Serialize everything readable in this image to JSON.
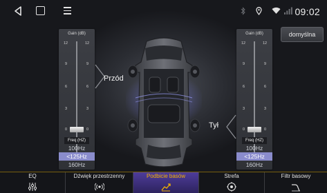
{
  "status": {
    "time": "09:02"
  },
  "default_button": "domyślna",
  "left_panel": {
    "gain_title": "Gain (dB)",
    "ticks": [
      "12",
      "9",
      "6",
      "3",
      "0"
    ],
    "freq_title": "Freq (HZ)",
    "options": [
      "100Hz",
      "<125Hz",
      "160Hz"
    ],
    "selected_index": 1,
    "gain_value_db": 0
  },
  "right_panel": {
    "gain_title": "Gain (dB)",
    "ticks": [
      "12",
      "9",
      "6",
      "3",
      "0"
    ],
    "freq_title": "Freq (HZ)",
    "options": [
      "100Hz",
      "<125Hz",
      "160Hz"
    ],
    "selected_index": 1,
    "gain_value_db": 0
  },
  "labels": {
    "front": "Przód",
    "rear": "Tył"
  },
  "tabs": [
    {
      "label": "EQ",
      "icon": "equalizer-icon"
    },
    {
      "label": "Dźwięk przestrzenny",
      "icon": "surround-icon"
    },
    {
      "label": "Podbicie basów",
      "icon": "bass-boost-icon",
      "active": true
    },
    {
      "label": "Strefa",
      "icon": "zone-icon"
    },
    {
      "label": "Filtr basowy",
      "icon": "bass-filter-icon"
    }
  ],
  "colors": {
    "accent": "#f4b200",
    "selected": "#8a8ccc",
    "active_tab": "#4e3c9a"
  }
}
